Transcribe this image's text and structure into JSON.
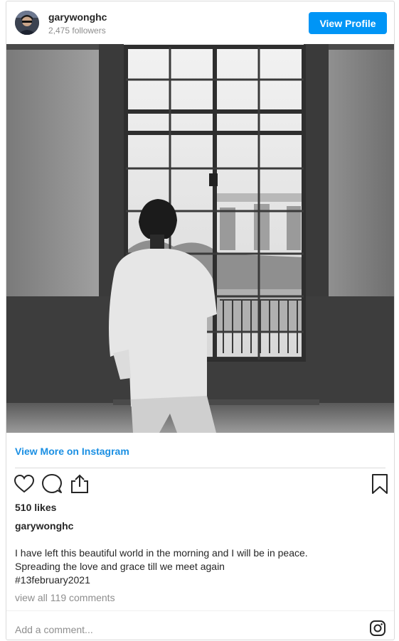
{
  "header": {
    "username": "garywonghc",
    "followers": "2,475 followers",
    "view_profile_label": "View Profile"
  },
  "photo": {
    "alt": "Black and white photo of a person looking out a tall window"
  },
  "link": {
    "view_more_label": "View More on Instagram"
  },
  "actions": {
    "icons": [
      "heart-icon",
      "comment-icon",
      "share-icon",
      "bookmark-icon"
    ]
  },
  "post": {
    "likes": "510 likes",
    "caption_user": "garywonghc",
    "caption_lines": [
      "I have left this beautiful world in the morning and I will be in peace.",
      "Spreading the love and grace till we meet again",
      "#13february2021"
    ],
    "view_comments": "view all 119 comments"
  },
  "comment_box": {
    "placeholder": "Add a comment..."
  },
  "colors": {
    "accent": "#0095f6",
    "link": "#1a8fe3",
    "muted": "#8e8e8e",
    "border": "#dbdbdb"
  }
}
